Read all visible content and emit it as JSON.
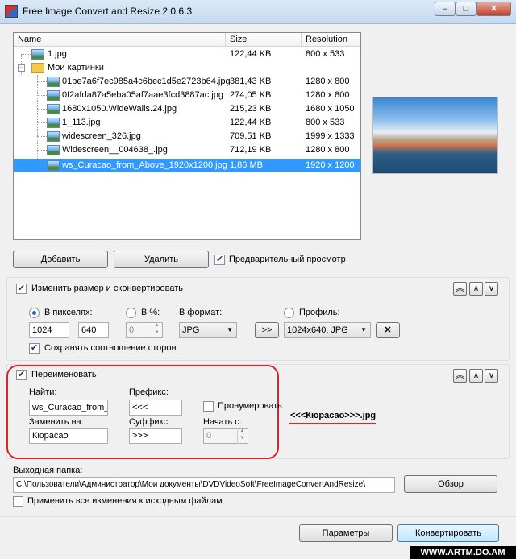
{
  "window": {
    "title": "Free Image Convert and Resize 2.0.6.3"
  },
  "file_list": {
    "headers": {
      "name": "Name",
      "size": "Size",
      "resolution": "Resolution"
    },
    "root_file": {
      "name": "1.jpg",
      "size": "122,44 KB",
      "resolution": "800 x 533"
    },
    "folder": "Мои картинки",
    "files": [
      {
        "name": "01be7a6f7ec985a4c6bec1d5e2723b64.jpg",
        "size": "381,43 KB",
        "resolution": "1280 x 800"
      },
      {
        "name": "0f2afda87a5eba05af7aae3fcd3887ac.jpg",
        "size": "274,05 KB",
        "resolution": "1280 x 800"
      },
      {
        "name": "1680x1050.WideWalls.24.jpg",
        "size": "215,23 KB",
        "resolution": "1680 x 1050"
      },
      {
        "name": "1_113.jpg",
        "size": "122,44 KB",
        "resolution": "800 x 533"
      },
      {
        "name": "widescreen_326.jpg",
        "size": "709,51 KB",
        "resolution": "1999 x 1333"
      },
      {
        "name": "Widescreen__004638_.jpg",
        "size": "712,19 KB",
        "resolution": "1280 x 800"
      },
      {
        "name": "ws_Curacao_from_Above_1920x1200.jpg",
        "size": "1,86 MB",
        "resolution": "1920 x 1200"
      }
    ]
  },
  "buttons": {
    "add": "Добавить",
    "delete": "Удалить",
    "preview": "Предварительный просмотр",
    "browse": "Обзор",
    "settings": "Параметры",
    "convert": "Конвертировать",
    "swap": ">>"
  },
  "resize": {
    "enable_label": "Изменить размер и сконвертировать",
    "pixels_label": "В пикселях:",
    "width": "1024",
    "height": "640",
    "percent_label": "В %:",
    "percent_value": "0",
    "format_label": "В формат:",
    "format_value": "JPG",
    "profile_label": "Профиль:",
    "profile_value": "1024x640, JPG",
    "keep_ratio": "Сохранять соотношение сторон"
  },
  "rename": {
    "enable_label": "Переименовать",
    "find_label": "Найти:",
    "find_value": "ws_Curacao_from_Ab",
    "replace_label": "Заменить на:",
    "replace_value": "Кюрасао",
    "prefix_label": "Префикс:",
    "prefix_value": "<<<",
    "suffix_label": "Суффикс:",
    "suffix_value": ">>>",
    "numerate_label": "Пронумеровать",
    "start_label": "Начать с:",
    "start_value": "0",
    "sample": "<<<Кюрасао>>>.jpg"
  },
  "output": {
    "label": "Выходная папка:",
    "path": "C:\\Пользователи\\Администратор\\Мои документы\\DVDVideoSoft\\FreeImageConvertAndResize\\",
    "apply_originals": "Применить все изменения к исходным файлам"
  },
  "watermark": "WWW.ARTM.DO.AM",
  "colors": {
    "selection": "#3399ff",
    "highlight_ring": "#d7262e"
  }
}
